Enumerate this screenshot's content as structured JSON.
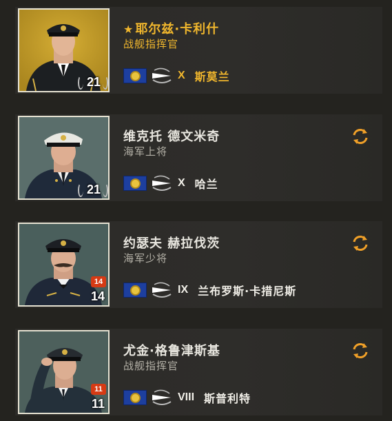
{
  "commanders": [
    {
      "name": "耶尔兹·卡利什",
      "rank": "战舰指挥官",
      "level": "21",
      "badge": null,
      "tier": "X",
      "ship": "斯莫兰",
      "favorite": true,
      "retrain_icon": null,
      "portrait_bg": "#c9a12d",
      "uniform": "#1c1f22",
      "cap": "#1c1f22"
    },
    {
      "name": "维克托  德文米奇",
      "rank": "海军上将",
      "level": "21",
      "badge": null,
      "tier": "X",
      "ship": "哈兰",
      "favorite": false,
      "retrain_icon": "refresh-icon",
      "portrait_bg": "#5a6e6b",
      "uniform": "#1f2a3a",
      "cap": "#e8e8e2"
    },
    {
      "name": "约瑟夫  赫拉伐茨",
      "rank": "海军少将",
      "level": "14",
      "badge": "14",
      "tier": "IX",
      "ship": "兰布罗斯·卡措尼斯",
      "favorite": false,
      "retrain_icon": "refresh-icon",
      "portrait_bg": "#4a5f5c",
      "uniform": "#1f2838",
      "cap": "#1c1f24"
    },
    {
      "name": "尤金·格鲁津斯基",
      "rank": "战舰指挥官",
      "level": "11",
      "badge": "11",
      "tier": "VIII",
      "ship": "斯普利特",
      "favorite": false,
      "retrain_icon": "refresh-icon",
      "portrait_bg": "#4d605c",
      "uniform": "#24303a",
      "cap": "#262b30"
    }
  ],
  "colors": {
    "accent_gold": "#f1b72d",
    "retrain_orange": "#f0a028",
    "badge_red": "#d63a14"
  }
}
